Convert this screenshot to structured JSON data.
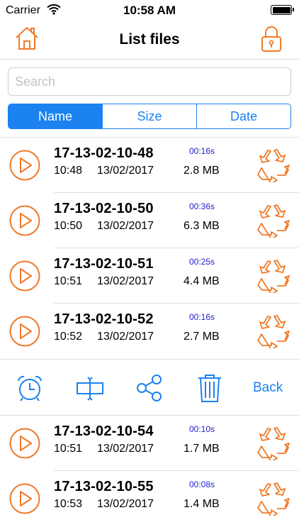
{
  "status_bar": {
    "carrier": "Carrier",
    "time": "10:58 AM"
  },
  "nav": {
    "title": "List files"
  },
  "search": {
    "placeholder": "Search",
    "value": ""
  },
  "sort_tabs": [
    {
      "label": "Name",
      "selected": true
    },
    {
      "label": "Size",
      "selected": false
    },
    {
      "label": "Date",
      "selected": false
    }
  ],
  "files": [
    {
      "name": "17-13-02-10-48",
      "time": "10:48",
      "date": "13/02/2017",
      "duration": "00:16s",
      "size": "2.8 MB"
    },
    {
      "name": "17-13-02-10-50",
      "time": "10:50",
      "date": "13/02/2017",
      "duration": "00:36s",
      "size": "6.3 MB"
    },
    {
      "name": "17-13-02-10-51",
      "time": "10:51",
      "date": "13/02/2017",
      "duration": "00:25s",
      "size": "4.4 MB"
    },
    {
      "name": "17-13-02-10-52",
      "time": "10:52",
      "date": "13/02/2017",
      "duration": "00:16s",
      "size": "2.7 MB"
    },
    {
      "name": "17-13-02-10-54",
      "time": "10:51",
      "date": "13/02/2017",
      "duration": "00:10s",
      "size": "1.7 MB"
    },
    {
      "name": "17-13-02-10-55",
      "time": "10:53",
      "date": "13/02/2017",
      "duration": "00:08s",
      "size": "1.4 MB"
    }
  ],
  "actions": {
    "alarm_icon": "alarm-clock-icon",
    "rename_icon": "rename-icon",
    "share_icon": "share-icon",
    "delete_icon": "trash-icon",
    "back_label": "Back"
  },
  "colors": {
    "accent_orange": "#f07a2a",
    "accent_blue": "#1b82f0",
    "duration_blue": "#2222cc"
  }
}
